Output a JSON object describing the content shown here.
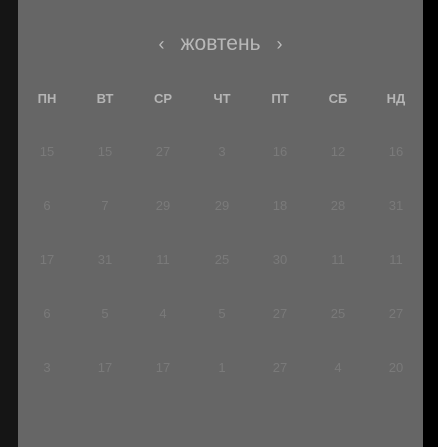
{
  "calendar": {
    "month": "жовтень",
    "prev_icon": "chevron-left-icon",
    "next_icon": "chevron-right-icon",
    "prev_label": "‹",
    "next_label": "›",
    "weekdays": [
      "ПН",
      "ВТ",
      "СР",
      "ЧТ",
      "ПТ",
      "СБ",
      "НД"
    ],
    "rows": [
      [
        "15",
        "15",
        "27",
        "3",
        "16",
        "12",
        "16"
      ],
      [
        "6",
        "7",
        "29",
        "29",
        "18",
        "28",
        "31"
      ],
      [
        "17",
        "31",
        "11",
        "25",
        "30",
        "11",
        "11"
      ],
      [
        "6",
        "5",
        "4",
        "5",
        "27",
        "25",
        "27"
      ],
      [
        "3",
        "17",
        "17",
        "1",
        "27",
        "4",
        "20"
      ]
    ]
  }
}
